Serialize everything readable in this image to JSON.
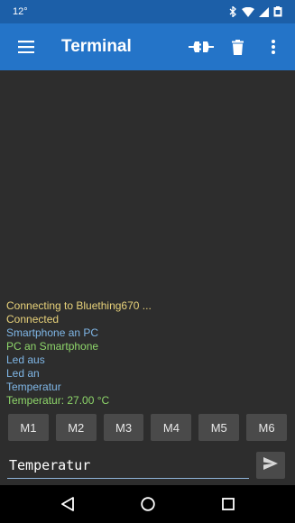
{
  "status_bar": {
    "time": "12°",
    "icons": [
      "bluetooth-icon",
      "wifi-icon",
      "signal-icon",
      "battery-icon"
    ]
  },
  "app_bar": {
    "menu_icon": "menu-icon",
    "title": "Terminal",
    "actions": [
      "connect-plug-icon",
      "trash-icon",
      "more-vert-icon"
    ]
  },
  "terminal": {
    "lines": [
      {
        "text": "Connecting to Bluething670 ...",
        "color": "#e8d27a"
      },
      {
        "text": "Connected",
        "color": "#e8d27a"
      },
      {
        "text": "Smartphone an PC",
        "color": "#7fb6e6"
      },
      {
        "text": "PC an Smartphone",
        "color": "#8ed66a"
      },
      {
        "text": "Led aus",
        "color": "#7fb6e6"
      },
      {
        "text": "Led an",
        "color": "#7fb6e6"
      },
      {
        "text": "Temperatur",
        "color": "#7fb6e6"
      },
      {
        "text": "Temperatur: 27.00 °C",
        "color": "#8ed66a"
      }
    ]
  },
  "macros": [
    "M1",
    "M2",
    "M3",
    "M4",
    "M5",
    "M6"
  ],
  "input": {
    "value": "Temperatur",
    "send_icon": "send-icon"
  },
  "nav_bar": {
    "icons": [
      "back-icon",
      "home-icon",
      "recents-icon"
    ]
  }
}
